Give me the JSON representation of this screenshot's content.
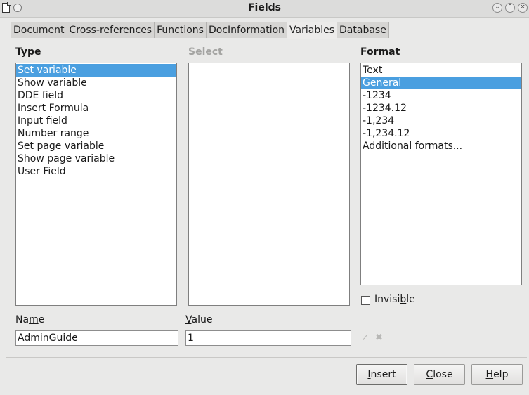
{
  "window": {
    "title": "Fields"
  },
  "tabs": [
    "Document",
    "Cross-references",
    "Functions",
    "DocInformation",
    "Variables",
    "Database"
  ],
  "active_tab": "Variables",
  "type": {
    "label_pre": "",
    "label_u": "T",
    "label_post": "ype",
    "items": [
      "Set variable",
      "Show variable",
      "DDE field",
      "Insert Formula",
      "Input field",
      "Number range",
      "Set page variable",
      "Show page variable",
      "User Field"
    ],
    "selected": "Set variable"
  },
  "select": {
    "label_pre": "S",
    "label_u": "e",
    "label_post": "lect",
    "items": []
  },
  "format": {
    "label_pre": "F",
    "label_u": "o",
    "label_post": "rmat",
    "items": [
      "Text",
      "General",
      "-1234",
      "-1234.12",
      "-1,234",
      "-1,234.12",
      "Additional formats..."
    ],
    "selected": "General"
  },
  "invisible": {
    "label_pre": "Invisi",
    "label_u": "b",
    "label_post": "le",
    "checked": false
  },
  "name": {
    "label_pre": "Na",
    "label_u": "m",
    "label_post": "e",
    "value": "AdminGuide"
  },
  "value_field": {
    "label_pre": "",
    "label_u": "V",
    "label_post": "alue",
    "value": "1"
  },
  "buttons": {
    "insert": {
      "pre": "",
      "u": "I",
      "post": "nsert"
    },
    "close": {
      "pre": "",
      "u": "C",
      "post": "lose"
    },
    "help": {
      "pre": "",
      "u": "H",
      "post": "elp"
    }
  }
}
